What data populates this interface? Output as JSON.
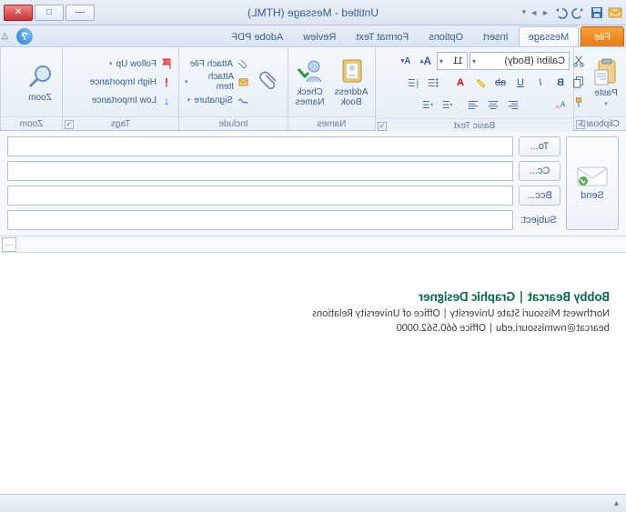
{
  "window": {
    "title": "Untitled - Message (HTML)"
  },
  "qat": {
    "items": [
      "save",
      "undo",
      "redo",
      "prev",
      "next"
    ]
  },
  "tabs": {
    "file": "File",
    "items": [
      "Message",
      "Insert",
      "Options",
      "Format Text",
      "Review",
      "Adobe PDF"
    ],
    "active": 0
  },
  "ribbon": {
    "clipboard": {
      "label": "Clipboard",
      "paste": "Paste"
    },
    "basictext": {
      "label": "Basic Text",
      "font": "Calibri (Body)",
      "size": "11"
    },
    "names": {
      "label": "Names",
      "address": "Address\nBook",
      "check": "Check\nNames"
    },
    "include": {
      "label": "Include",
      "attach_file": "Attach File",
      "attach_item": "Attach Item",
      "signature": "Signature"
    },
    "tags": {
      "label": "Tags",
      "follow": "Follow Up",
      "high": "High Importance",
      "low": "Low Importance"
    },
    "zoom": {
      "label": "Zoom",
      "zoom": "Zoom"
    }
  },
  "address": {
    "send": "Send",
    "to": "To...",
    "cc": "Cc...",
    "bcc": "Bcc...",
    "subject": "Subject:",
    "to_val": "",
    "cc_val": "",
    "bcc_val": "",
    "subject_val": ""
  },
  "signature": {
    "name": "Bobby Bearcat | Graphic Designer",
    "line2": "Northwest Missouri State University   |   Office of University Relations",
    "line3": "bearcat@nwmissouri.edu   |   Office 660.562.0000"
  }
}
